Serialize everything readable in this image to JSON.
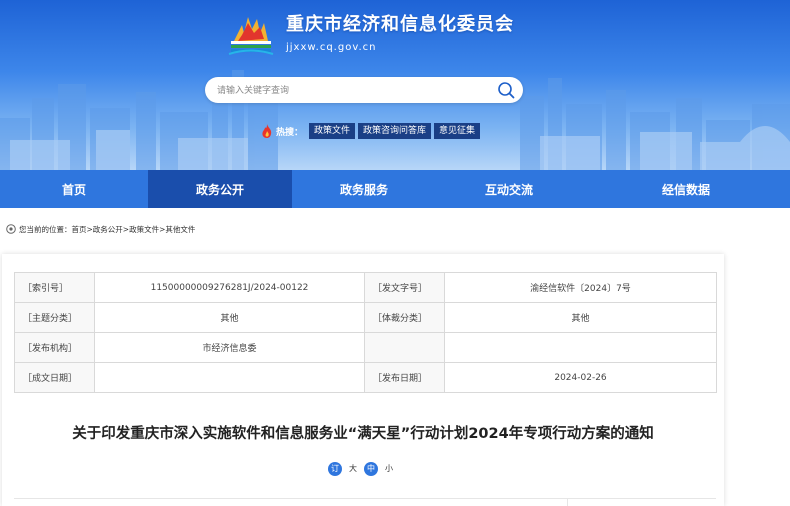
{
  "site": {
    "name": "重庆市经济和信息化委员会",
    "domain": "jjxxw.cq.gov.cn"
  },
  "search": {
    "placeholder": "请输入关键字查询"
  },
  "hot": {
    "label": "热搜：",
    "tags": [
      "政策文件",
      "政策咨询问答库",
      "意见征集"
    ]
  },
  "nav": {
    "items": [
      "首页",
      "政务公开",
      "政务服务",
      "互动交流",
      "经信数据"
    ],
    "active_index": 1
  },
  "breadcrumb": {
    "prefix": "您当前的位置：",
    "items": [
      "首页",
      "政务公开",
      "政策文件",
      "其他文件"
    ],
    "separator": ">"
  },
  "meta": {
    "rows": [
      [
        {
          "label": "［索引号］",
          "value": "11500000009276281J/2024-00122"
        },
        {
          "label": "［发文字号］",
          "value": "渝经信软件〔2024〕7号"
        }
      ],
      [
        {
          "label": "［主题分类］",
          "value": "其他"
        },
        {
          "label": "［体裁分类］",
          "value": "其他"
        }
      ],
      [
        {
          "label": "［发布机构］",
          "value": "市经济信息委"
        },
        {
          "label": "",
          "value": ""
        }
      ],
      [
        {
          "label": "［成文日期］",
          "value": ""
        },
        {
          "label": "［发布日期］",
          "value": "2024-02-26"
        }
      ]
    ]
  },
  "document": {
    "title": "关于印发重庆市深入实施软件和信息服务业“满天星”行动计划2024年专项行动方案的通知"
  },
  "font_size": {
    "options": [
      "订",
      "大",
      "中",
      "小"
    ],
    "accent_indices": [
      0,
      2
    ]
  },
  "colors": {
    "brand_blue": "#2f76de",
    "nav_active": "#1a4eac",
    "hot_tag_bg": "#1a3f86"
  }
}
